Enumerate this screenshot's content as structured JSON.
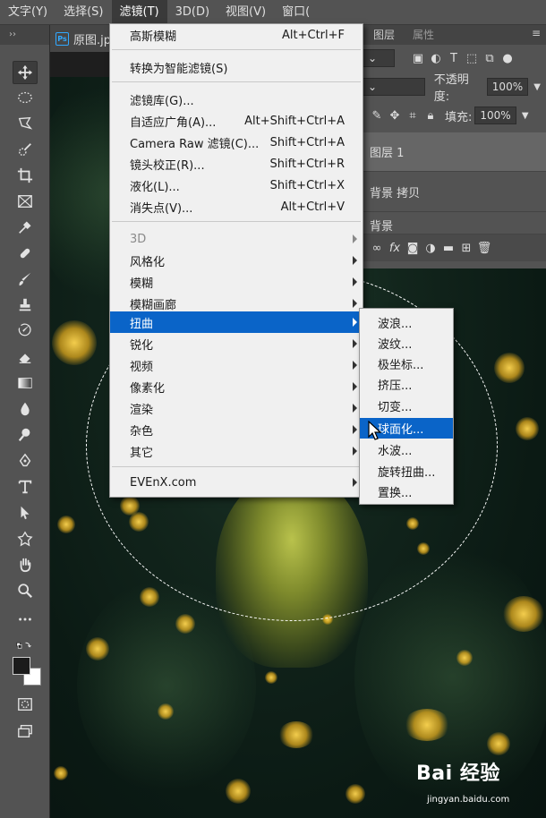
{
  "menubar": {
    "items": [
      {
        "label": "文字(Y)"
      },
      {
        "label": "选择(S)"
      },
      {
        "label": "滤镜(T)",
        "active": true
      },
      {
        "label": "3D(D)"
      },
      {
        "label": "视图(V)"
      },
      {
        "label": "窗口("
      }
    ]
  },
  "document": {
    "tab_label": "原图.jp",
    "badge": "Ps"
  },
  "right_panels": {
    "tab_layers": "图层",
    "tab_properties": "属性",
    "opacity_label": "不透明度:",
    "opacity_value": "100%",
    "fill_label": "填充:",
    "fill_value": "100%",
    "layers": [
      {
        "name": "图层 1"
      },
      {
        "name": "背景 拷贝"
      },
      {
        "name": "背景"
      }
    ],
    "fx_label": "fx"
  },
  "filter_menu": {
    "items": [
      {
        "label": "高斯模糊",
        "shortcut": "Alt+Ctrl+F"
      },
      {
        "label": "转换为智能滤镜(S)",
        "shortcut": ""
      },
      {
        "label": "滤镜库(G)...",
        "shortcut": ""
      },
      {
        "label": "自适应广角(A)...",
        "shortcut": "Alt+Shift+Ctrl+A"
      },
      {
        "label": "Camera Raw 滤镜(C)...",
        "shortcut": "Shift+Ctrl+A"
      },
      {
        "label": "镜头校正(R)...",
        "shortcut": "Shift+Ctrl+R"
      },
      {
        "label": "液化(L)...",
        "shortcut": "Shift+Ctrl+X"
      },
      {
        "label": "消失点(V)...",
        "shortcut": "Alt+Ctrl+V"
      },
      {
        "label": "3D",
        "shortcut": "",
        "submenu": true,
        "disabled": true
      },
      {
        "label": "风格化",
        "shortcut": "",
        "submenu": true
      },
      {
        "label": "模糊",
        "shortcut": "",
        "submenu": true
      },
      {
        "label": "模糊画廊",
        "shortcut": "",
        "submenu": true
      },
      {
        "label": "扭曲",
        "shortcut": "",
        "submenu": true,
        "highlight": true
      },
      {
        "label": "锐化",
        "shortcut": "",
        "submenu": true
      },
      {
        "label": "视频",
        "shortcut": "",
        "submenu": true
      },
      {
        "label": "像素化",
        "shortcut": "",
        "submenu": true
      },
      {
        "label": "渲染",
        "shortcut": "",
        "submenu": true
      },
      {
        "label": "杂色",
        "shortcut": "",
        "submenu": true
      },
      {
        "label": "其它",
        "shortcut": "",
        "submenu": true
      },
      {
        "label": "EVEnX.com",
        "shortcut": "",
        "submenu": true
      }
    ]
  },
  "distort_menu": {
    "items": [
      {
        "label": "波浪..."
      },
      {
        "label": "波纹..."
      },
      {
        "label": "极坐标..."
      },
      {
        "label": "挤压..."
      },
      {
        "label": "切变..."
      },
      {
        "label": "球面化...",
        "highlight": true
      },
      {
        "label": "水波..."
      },
      {
        "label": "旋转扭曲..."
      },
      {
        "label": "置换..."
      }
    ]
  },
  "watermark": {
    "logo": "Bai 经验",
    "url": "jingyan.baidu.com"
  },
  "colors": {
    "menu_highlight": "#0a64c8",
    "panel_bg": "#535353",
    "menu_bg": "#f0f0f0"
  }
}
